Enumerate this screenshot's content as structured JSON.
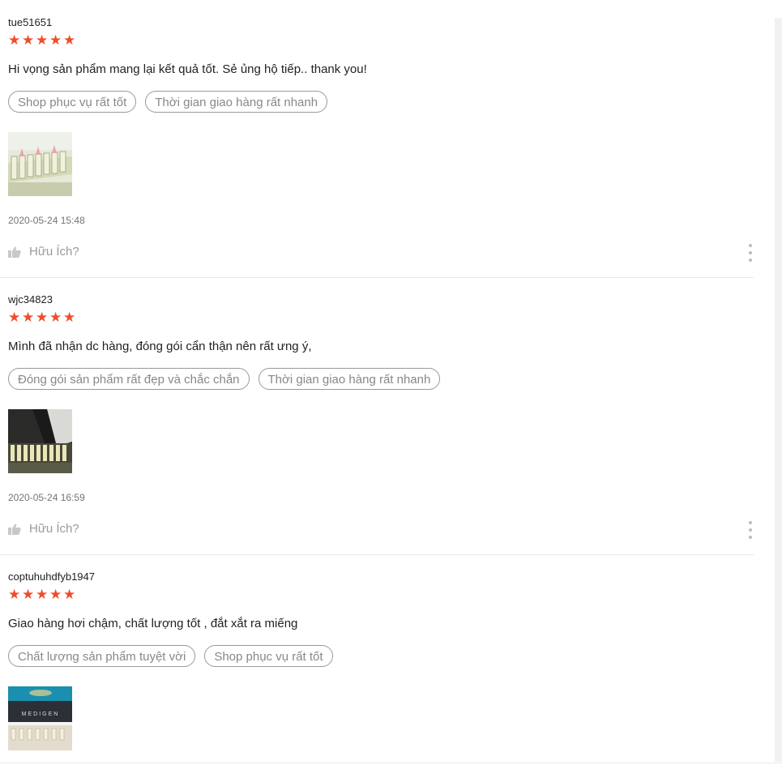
{
  "helpful_label": "Hữu Ích?",
  "accent_color": "#ee4d2d",
  "reviews": [
    {
      "username": "tue51651",
      "rating": 5,
      "comment": "Hi vọng sản phẩm mang lại kết quả tốt. Sẻ ủng hộ tiếp.. thank you!",
      "tags": [
        "Shop phục vụ rất tốt",
        "Thời gian giao hàng rất nhanh"
      ],
      "date": "2020-05-24 15:48"
    },
    {
      "username": "wjc34823",
      "rating": 5,
      "comment": "Mình đã nhận dc hàng, đóng gói cẩn thận nên rất ưng ý,",
      "tags": [
        "Đóng gói sản phẩm rất đẹp và chắc chắn",
        "Thời gian giao hàng rất nhanh"
      ],
      "date": "2020-05-24 16:59"
    },
    {
      "username": "coptuhuhdfyb1947",
      "rating": 5,
      "comment": "Giao hàng hơi chậm, chất lượng tốt , đắt xắt ra miếng",
      "tags": [
        "Chất lượng sản phẩm tuyệt vời",
        "Shop phục vụ rất tốt"
      ],
      "photo_text": "MEDIGEN"
    }
  ]
}
